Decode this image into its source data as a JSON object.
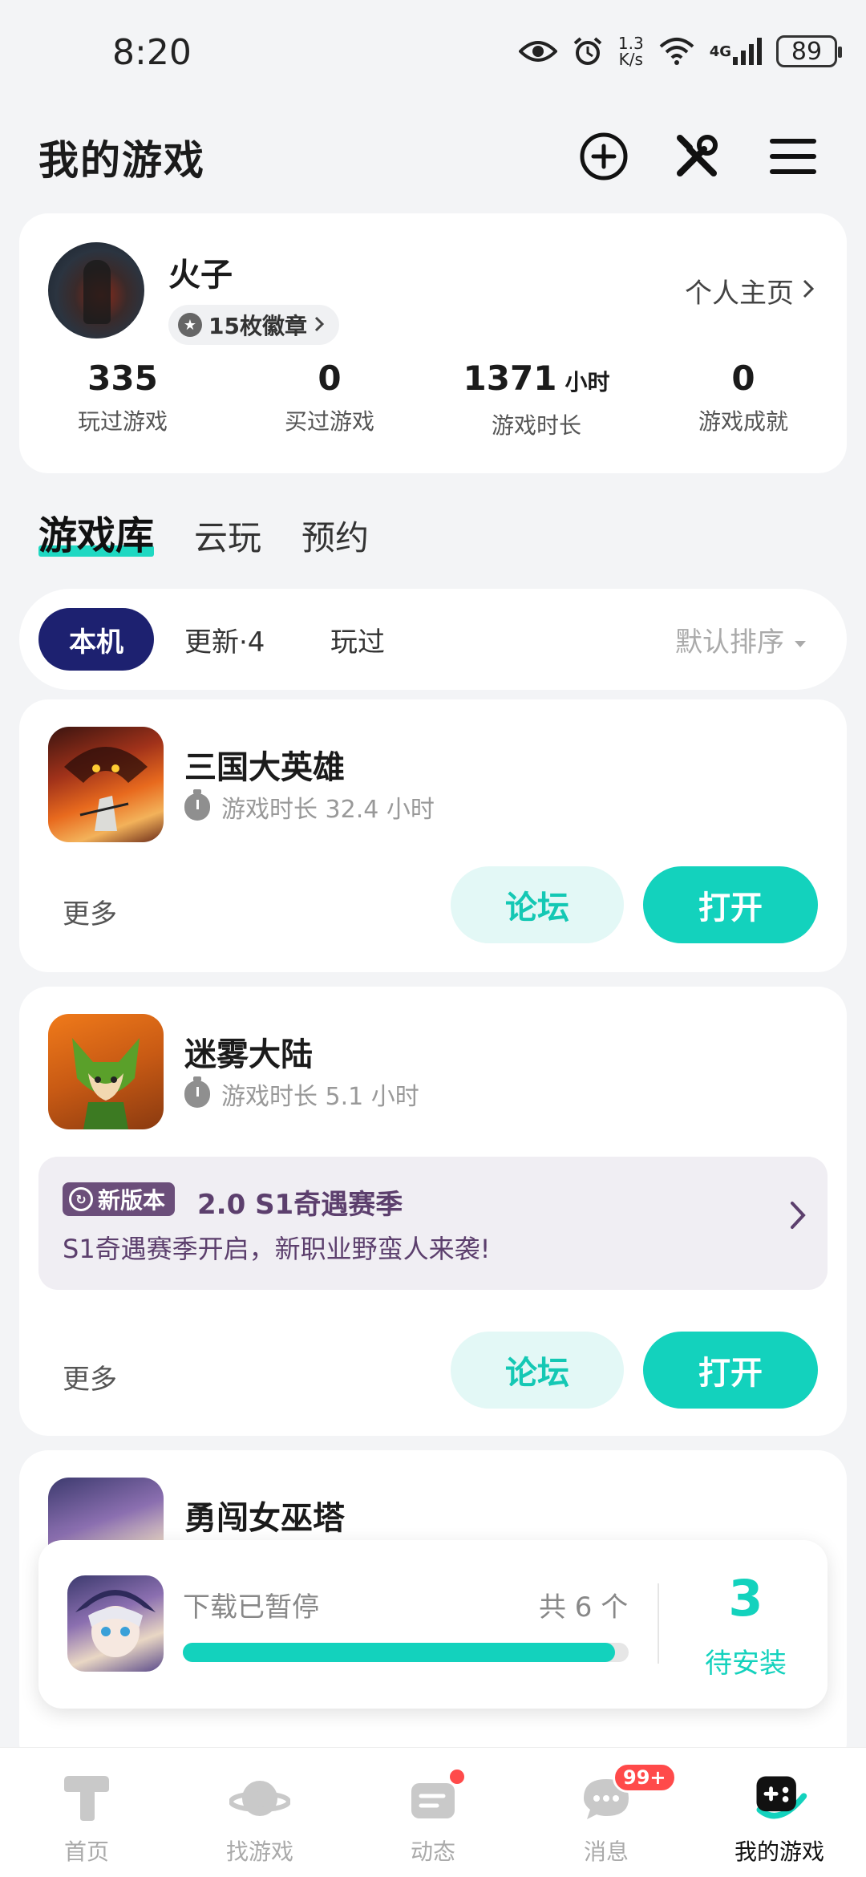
{
  "status_bar": {
    "time": "8:20",
    "net_speed_top": "1.3",
    "net_speed_bottom": "K/s",
    "network": "4G",
    "battery": "89"
  },
  "header": {
    "title": "我的游戏",
    "icons": [
      "add-circle-icon",
      "tools-icon",
      "menu-icon"
    ]
  },
  "profile": {
    "name": "火子",
    "badges": "15枚徽章",
    "home_link": "个人主页",
    "stats": [
      {
        "value": "335",
        "unit": "",
        "label": "玩过游戏"
      },
      {
        "value": "0",
        "unit": "",
        "label": "买过游戏"
      },
      {
        "value": "1371",
        "unit": "小时",
        "label": "游戏时长"
      },
      {
        "value": "0",
        "unit": "",
        "label": "游戏成就"
      }
    ]
  },
  "library_tabs": [
    "游戏库",
    "云玩",
    "预约"
  ],
  "filters": {
    "chips": [
      "本机",
      "更新·4",
      "玩过"
    ],
    "sort": "默认排序"
  },
  "games": [
    {
      "title": "三国大英雄",
      "playtime": "游戏时长 32.4 小时",
      "more": "更多",
      "forum": "论坛",
      "open": "打开"
    },
    {
      "title": "迷雾大陆",
      "playtime": "游戏时长 5.1 小时",
      "news_tag": "新版本",
      "news_title": "2.0 S1奇遇赛季",
      "news_desc": "S1奇遇赛季开启，新职业野蛮人来袭!",
      "more": "更多",
      "forum": "论坛",
      "open": "打开"
    },
    {
      "title": "勇闯女巫塔"
    }
  ],
  "download": {
    "status": "下载已暂停",
    "count": "共 6 个",
    "progress": 0.97,
    "pending_count": "3",
    "pending_label": "待安装"
  },
  "bottom_nav": [
    {
      "label": "首页",
      "icon": "home-icon"
    },
    {
      "label": "找游戏",
      "icon": "planet-icon"
    },
    {
      "label": "动态",
      "icon": "feed-icon"
    },
    {
      "label": "消息",
      "icon": "message-icon",
      "badge": "99+"
    },
    {
      "label": "我的游戏",
      "icon": "gamepad-icon"
    }
  ],
  "colors": {
    "accent": "#13d2bd",
    "accent_light": "#e3f8f6",
    "active_chip": "#1d2170",
    "badge_red": "#ff4a4a",
    "news_purple": "#5c3f6d"
  }
}
